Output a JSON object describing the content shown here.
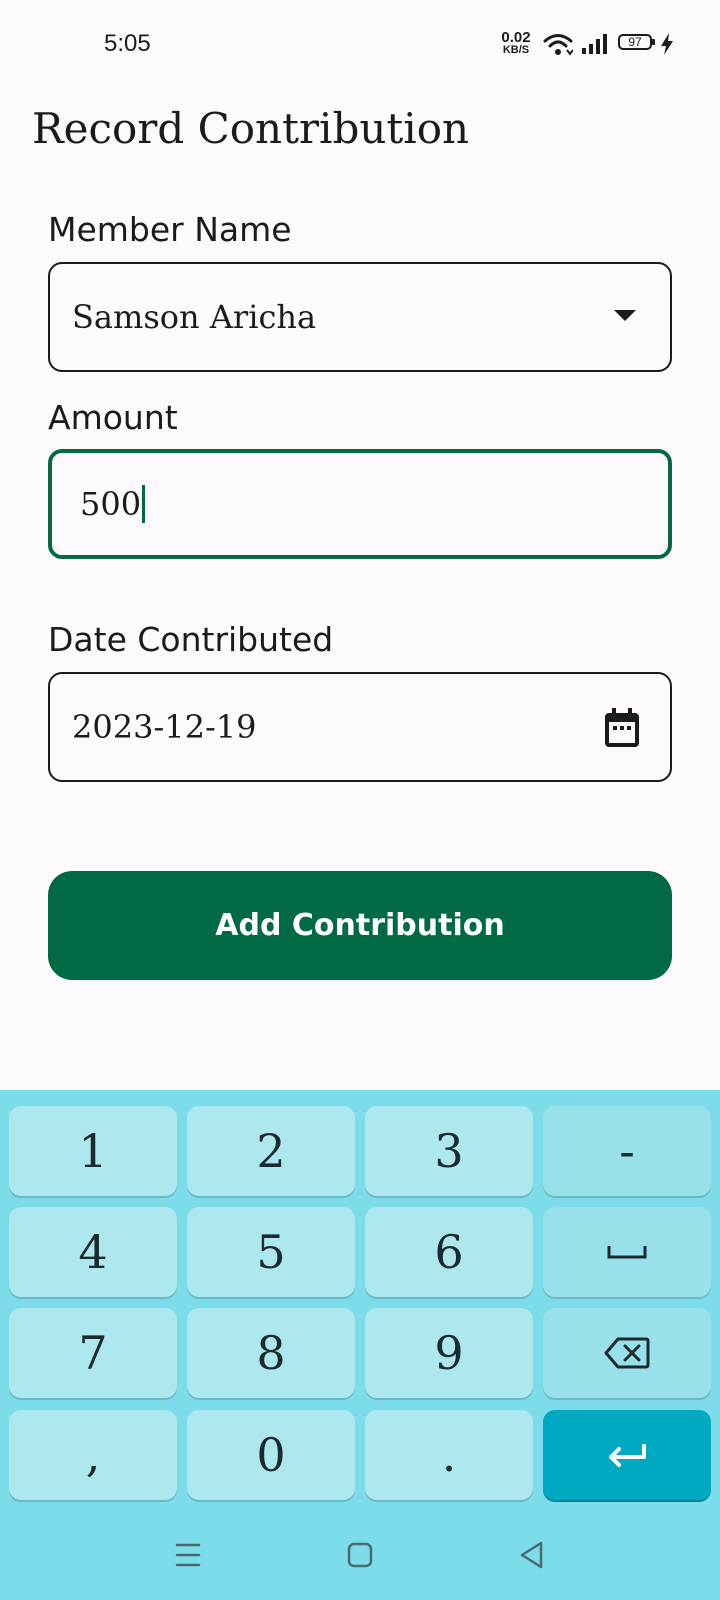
{
  "status_bar": {
    "time": "5:05",
    "net_speed_value": "0.02",
    "net_speed_unit": "KB/S",
    "battery_level": "97"
  },
  "page": {
    "title": "Record Contribution"
  },
  "form": {
    "member_label": "Member Name",
    "member_value": "Samson Aricha",
    "amount_label": "Amount",
    "amount_value": "500",
    "date_label": "Date Contributed",
    "date_value": "2023-12-19",
    "submit_label": "Add Contribution"
  },
  "colors": {
    "accent": "#006a42",
    "keyboard_bg": "#7ddce9",
    "key_bg": "#ade8ef",
    "enter_key": "#00a9c2"
  },
  "keyboard": {
    "keys": [
      "1",
      "2",
      "3",
      "-",
      "4",
      "5",
      "6",
      "space-icon",
      "7",
      "8",
      "9",
      "backspace-icon",
      ",",
      "0",
      ".",
      "enter-icon"
    ],
    "k1": "1",
    "k2": "2",
    "k3": "3",
    "kminus": "-",
    "k4": "4",
    "k5": "5",
    "k6": "6",
    "k7": "7",
    "k8": "8",
    "k9": "9",
    "kcomma": ",",
    "k0": "0",
    "kdot": "."
  },
  "nav_bar": {
    "icons": [
      "menu-icon",
      "home-icon",
      "back-icon"
    ]
  }
}
